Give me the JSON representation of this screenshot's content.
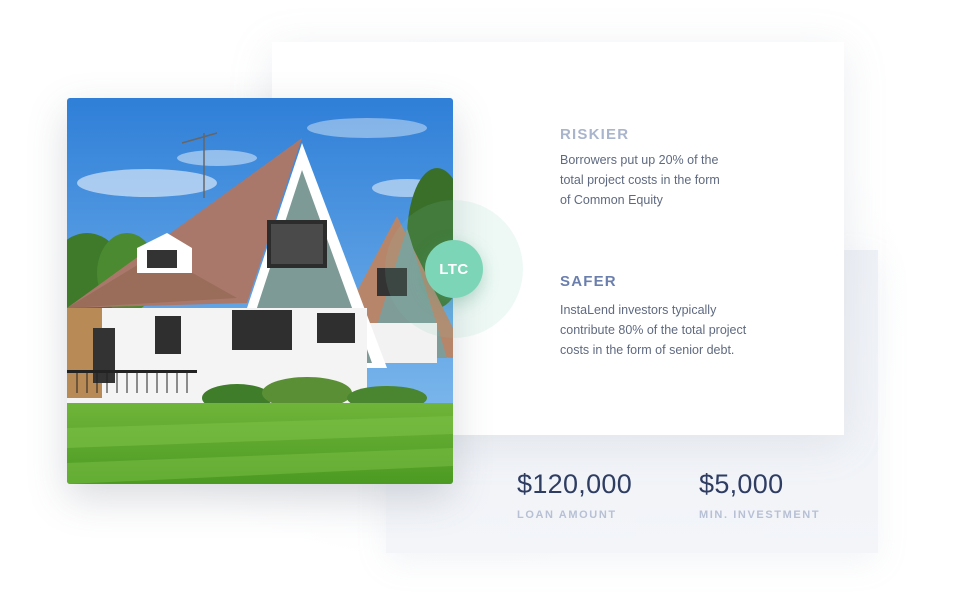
{
  "badge": {
    "label": "LTC",
    "color": "#7dd5b7"
  },
  "riskier": {
    "title": "RISKIER",
    "lines": [
      "Borrowers put up 20% of the",
      "total project costs in the form",
      "of Common Equity"
    ]
  },
  "safer": {
    "title": "SAFER",
    "lines": [
      "InstaLend investors typically",
      "contribute 80% of the total project",
      "costs in the form of senior debt."
    ]
  },
  "stats": {
    "loan_amount": {
      "value": "$120,000",
      "label": "LOAN AMOUNT"
    },
    "min_investment": {
      "value": "$5,000",
      "label": "MIN. INVESTMENT"
    }
  },
  "colors": {
    "accent_green": "#7dd5b7",
    "heading_light": "#a9b5cc",
    "heading_dark": "#6b7fae",
    "stat_value": "#2f3d63",
    "stat_label": "#b7c0d4"
  }
}
